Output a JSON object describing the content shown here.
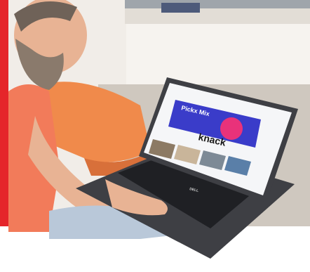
{
  "photo": {
    "colors": {
      "frame_red": "#e5252a",
      "wall": "#f1ede8",
      "shelf": "#d9d4cd",
      "floor": "#cfc8bf",
      "sofa": "#f08a4b",
      "sofa_shadow": "#d8703a",
      "shirt": "#f27b5a",
      "skin": "#e8b394",
      "beard": "#8a7a6c",
      "hair": "#6f6258",
      "jeans": "#b9c8d9",
      "laptop_body": "#3e3f44",
      "laptop_keys": "#1f2024",
      "screen_bg": "#f5f6f8",
      "banner": "#3a3cc9",
      "banner_accent": "#e9327a"
    },
    "screen": {
      "banner_title": "Pickx Mix",
      "logo": "knack",
      "brand_mark": "DELL"
    }
  }
}
